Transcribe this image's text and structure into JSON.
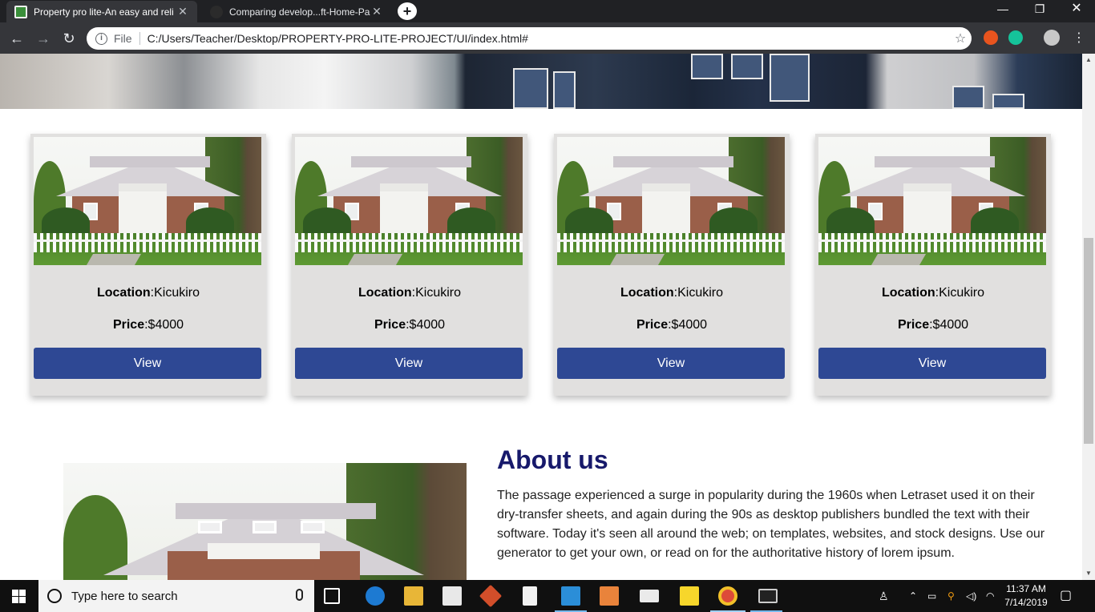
{
  "browser": {
    "tabs": [
      {
        "title": "Property pro lite-An easy and reli",
        "active": true
      },
      {
        "title": "Comparing develop...ft-Home-Pa",
        "active": false
      }
    ],
    "address": {
      "scheme": "File",
      "url": "C:/Users/Teacher/Desktop/PROPERTY-PRO-LITE-PROJECT/UI/index.html#"
    }
  },
  "cards": [
    {
      "location_label": "Location",
      "location_value": ":Kicukiro",
      "price_label": "Price",
      "price_value": ":$4000",
      "button_label": "View"
    },
    {
      "location_label": "Location",
      "location_value": ":Kicukiro",
      "price_label": "Price",
      "price_value": ":$4000",
      "button_label": "View"
    },
    {
      "location_label": "Location",
      "location_value": ":Kicukiro",
      "price_label": "Price",
      "price_value": ":$4000",
      "button_label": "View"
    },
    {
      "location_label": "Location",
      "location_value": ":Kicukiro",
      "price_label": "Price",
      "price_value": ":$4000",
      "button_label": "View"
    }
  ],
  "about": {
    "title": "About us",
    "text": "The passage experienced a surge in popularity during the 1960s when Letraset used it on their dry-transfer sheets, and again during the 90s as desktop publishers bundled the text with their software. Today it's seen all around the web; on templates, websites, and stock designs. Use our generator to get your own, or read on for the authoritative history of lorem ipsum."
  },
  "taskbar": {
    "search_placeholder": "Type here to search",
    "time": "11:37 AM",
    "date": "7/14/2019"
  },
  "colors": {
    "button": "#2e4894",
    "about_title": "#17196b",
    "card_bg": "#e1e0df"
  }
}
